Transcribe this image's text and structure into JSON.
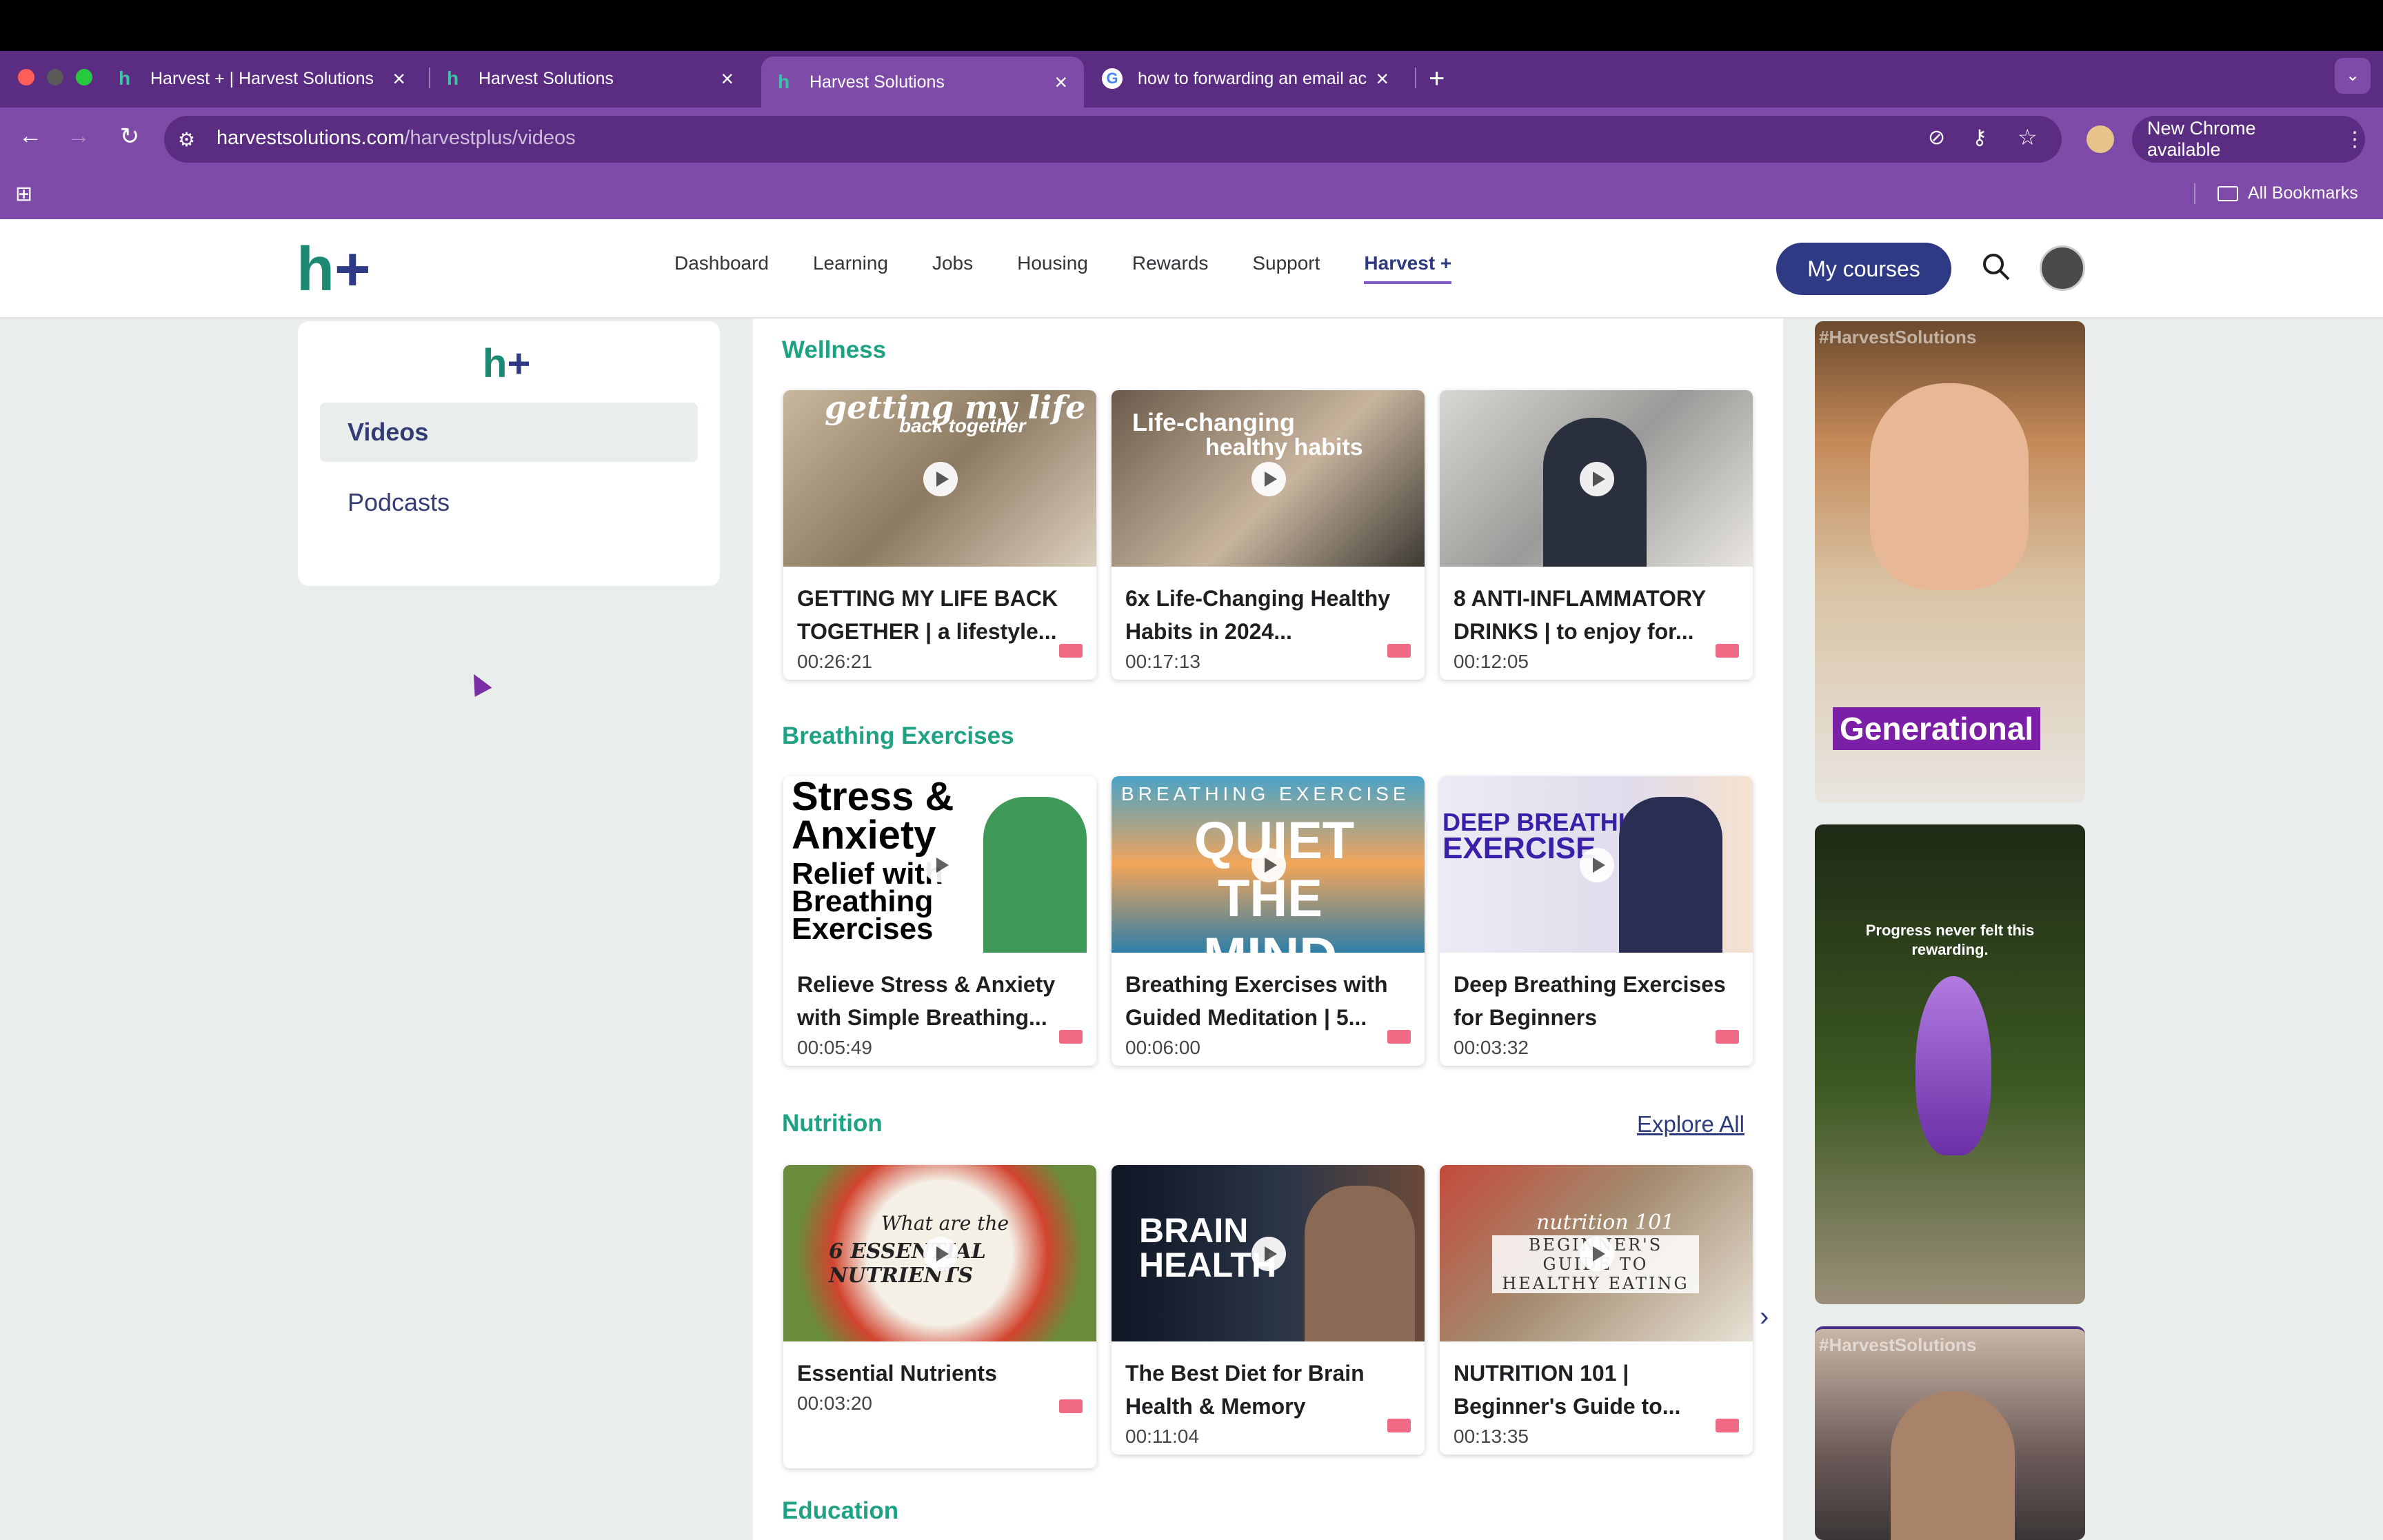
{
  "browser": {
    "tabs": [
      {
        "title": "Harvest + | Harvest Solutions"
      },
      {
        "title": "Harvest Solutions"
      },
      {
        "title": "Harvest Solutions"
      },
      {
        "title": "how to forwarding an email ac"
      }
    ],
    "url_host": "harvestsolutions.com",
    "url_path": "/harvestplus/videos",
    "new_chrome": "New Chrome available",
    "all_bookmarks": "All Bookmarks"
  },
  "site": {
    "logo_text": "h+",
    "nav": [
      "Dashboard",
      "Learning",
      "Jobs",
      "Housing",
      "Rewards",
      "Support",
      "Harvest +"
    ],
    "my_courses": "My courses"
  },
  "sidebar": {
    "items": [
      {
        "label": "Videos"
      },
      {
        "label": "Podcasts"
      }
    ]
  },
  "sections": [
    {
      "title": "Wellness",
      "cards": [
        {
          "title": "GETTING MY LIFE BACK TOGETHER | a lifestyle...",
          "duration": "00:26:21",
          "thumb_text": "getting my life",
          "thumb_sub": "back together"
        },
        {
          "title": "6x Life-Changing Healthy Habits in 2024...",
          "duration": "00:17:13",
          "thumb_text": "Life-changing",
          "thumb_sub": "healthy habits"
        },
        {
          "title": "8 ANTI-INFLAMMATORY DRINKS | to enjoy for...",
          "duration": "00:12:05",
          "thumb_text": "",
          "thumb_sub": ""
        }
      ]
    },
    {
      "title": "Breathing Exercises",
      "cards": [
        {
          "title": "Relieve Stress & Anxiety with Simple Breathing...",
          "duration": "00:05:49",
          "thumb_text": "Stress & Anxiety",
          "thumb_sub": "Relief with Breathing Exercises"
        },
        {
          "title": "Breathing Exercises with Guided Meditation | 5...",
          "duration": "00:06:00",
          "thumb_text": "QUIET THE MIND",
          "thumb_sub": "BREATHING EXERCISE"
        },
        {
          "title": "Deep Breathing Exercises for Beginners",
          "duration": "00:03:32",
          "thumb_text": "DEEP BREATHING",
          "thumb_sub": "EXERCISE"
        }
      ]
    },
    {
      "title": "Nutrition",
      "explore": "Explore All",
      "cards": [
        {
          "title": "Essential Nutrients",
          "duration": "00:03:20",
          "thumb_text": "6 ESSENTIAL NUTRIENTS",
          "thumb_sub": "What are the"
        },
        {
          "title": "The Best Diet for Brain Health & Memory",
          "duration": "00:11:04",
          "thumb_text": "BRAIN HEALTH",
          "thumb_sub": ""
        },
        {
          "title": "NUTRITION 101 | Beginner's Guide to...",
          "duration": "00:13:35",
          "thumb_text": "BEGINNER'S GUIDE TO HEALTHY EATING",
          "thumb_sub": "nutrition 101"
        }
      ]
    },
    {
      "title": "Education",
      "cards": []
    }
  ],
  "promos": [
    {
      "hashtag": "#HarvestSolutions",
      "caption": "Generational"
    },
    {
      "caption": "Progress never felt this rewarding."
    },
    {
      "hashtag": "#HarvestSolutions"
    }
  ]
}
